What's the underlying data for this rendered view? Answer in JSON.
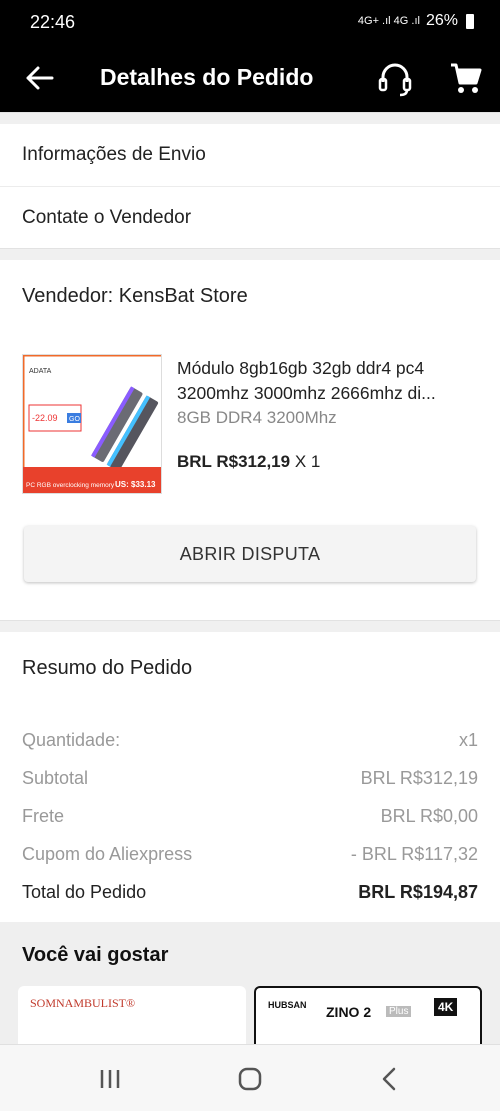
{
  "status_bar": {
    "time": "22:46",
    "network": "4G+ .ıl 4G .ıl",
    "battery": "26%"
  },
  "app_bar": {
    "title": "Detalhes do Pedido",
    "icons": [
      "back-arrow-icon",
      "headset-icon",
      "cart-icon"
    ]
  },
  "links": {
    "shipping_info": "Informações de Envio",
    "contact_seller": "Contate o Vendedor"
  },
  "seller": {
    "label": "Vendedor: KensBat Store"
  },
  "product": {
    "image_badge_brand": "ADATA",
    "image_badge_price": "-22.09",
    "image_badge_go": "GO",
    "image_caption": "PC RGB overclocking memory",
    "image_price": "US: $33.13",
    "title_line1": "Módulo 8gb16gb 32gb ddr4 pc4",
    "title_line2": "3200mhz 3000mhz 2666mhz di...",
    "variant": "8GB DDR4 3200Mhz",
    "price": "BRL R$312,19",
    "quantity": "X 1"
  },
  "actions": {
    "dispute": "ABRIR DISPUTA"
  },
  "summary": {
    "title": "Resumo do Pedido",
    "rows": [
      {
        "label": "Quantidade:",
        "value": "x1"
      },
      {
        "label": "Subtotal",
        "value": "BRL R$312,19"
      },
      {
        "label": "Frete",
        "value": "BRL R$0,00"
      },
      {
        "label": "Cupom do Aliexpress",
        "value": "- BRL R$117,32"
      }
    ],
    "total_label": "Total do Pedido",
    "total_value": "BRL R$194,87"
  },
  "recommendations": {
    "title": "Você vai gostar",
    "items": [
      {
        "brand": "SOMNAMBULIST®"
      },
      {
        "brand": "HUBSAN",
        "model": "ZINO 2",
        "model_suffix": "Plus",
        "badge": "4K"
      }
    ]
  },
  "colors": {
    "app_bar_bg": "#000000",
    "page_bg": "#f0f0f0",
    "muted_text": "#999999"
  }
}
